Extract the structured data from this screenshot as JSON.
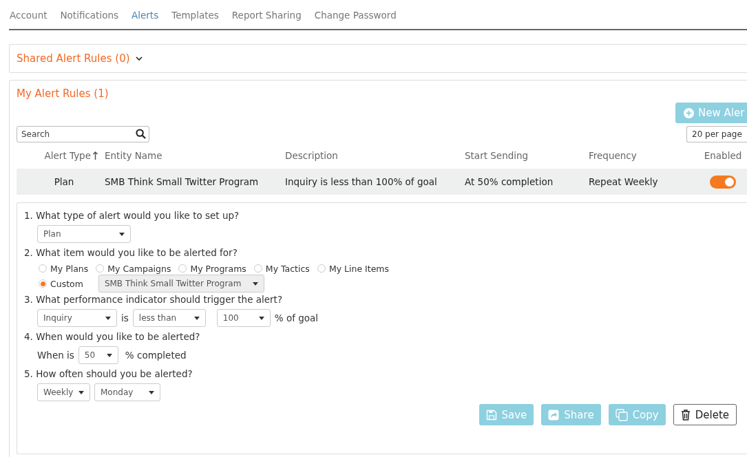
{
  "tabs": [
    {
      "label": "Account",
      "selected": false
    },
    {
      "label": "Notifications",
      "selected": false
    },
    {
      "label": "Alerts",
      "selected": true
    },
    {
      "label": "Templates",
      "selected": false
    },
    {
      "label": "Report Sharing",
      "selected": false
    },
    {
      "label": "Change Password",
      "selected": false
    }
  ],
  "shared_rules": {
    "title": "Shared Alert Rules (0)",
    "expanded": false
  },
  "my_rules": {
    "title": "My Alert Rules (1)",
    "new_button": "New Aler",
    "search": {
      "placeholder": "Search"
    },
    "page_size": "20 per page",
    "table": {
      "columns": [
        {
          "label": "Alert Type",
          "sorted": true
        },
        {
          "label": "Entity Name",
          "sorted": false
        },
        {
          "label": "Description",
          "sorted": false
        },
        {
          "label": "Start Sending",
          "sorted": false
        },
        {
          "label": "Frequency",
          "sorted": false
        },
        {
          "label": "Enabled",
          "sorted": false
        }
      ],
      "rows": [
        {
          "cells": [
            "Plan",
            "SMB Think Small Twitter Program",
            "Inquiry is less than 100% of goal",
            "At 50% completion",
            "Repeat Weekly"
          ],
          "enabled": true
        }
      ]
    }
  },
  "form": {
    "q1": {
      "question": "1. What type of alert would you like to set up?",
      "type": "Plan"
    },
    "q2": {
      "question": "2. What item would you like to be alerted for?",
      "options": [
        {
          "label": "My Plans",
          "selected": false
        },
        {
          "label": "My Campaigns",
          "selected": false
        },
        {
          "label": "My Programs",
          "selected": false
        },
        {
          "label": "My Tactics",
          "selected": false
        },
        {
          "label": "My Line Items",
          "selected": false
        }
      ],
      "custom": {
        "label": "Custom",
        "selected": true
      },
      "custom_value": "SMB Think Small Twitter Program"
    },
    "q3": {
      "question": "3. What performance indicator should trigger the alert?",
      "metric": "Inquiry",
      "is": "is",
      "operator": "less than",
      "value": "100",
      "suffix": "% of goal"
    },
    "q4": {
      "question": "4. When would you like to be alerted?",
      "prefix": "When is",
      "value": "50",
      "suffix": "% completed"
    },
    "q5": {
      "question": "5. How often should you be alerted?",
      "frequency": "Weekly",
      "day": "Monday"
    },
    "buttons": [
      {
        "label": "Save",
        "kind": "save"
      },
      {
        "label": "Share",
        "kind": "share"
      },
      {
        "label": "Copy",
        "kind": "copy"
      },
      {
        "label": "Delete",
        "kind": "delete"
      }
    ]
  }
}
